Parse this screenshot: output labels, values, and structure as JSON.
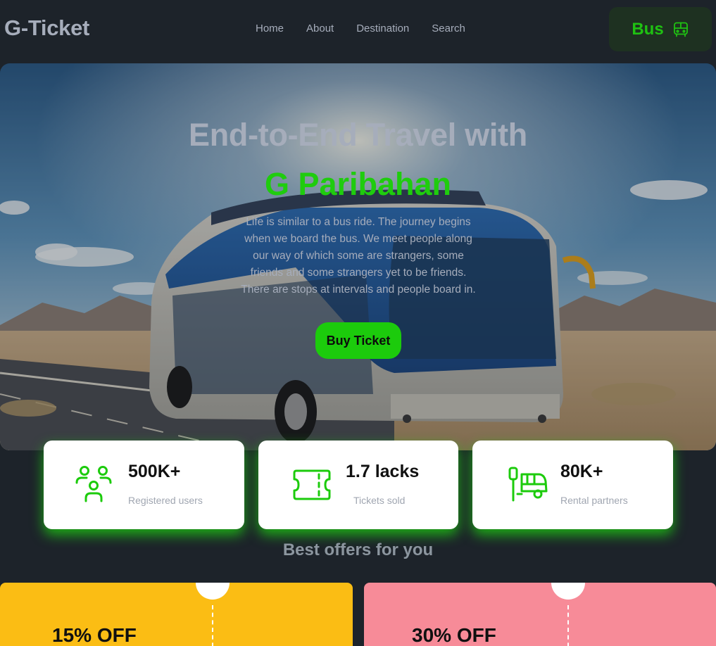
{
  "navbar": {
    "brand": "G-Ticket",
    "links": [
      "Home",
      "About",
      "Destination",
      "Search"
    ],
    "bus_button": {
      "label": "Bus",
      "icon": "bus-icon"
    }
  },
  "hero": {
    "title": "End-to-End Travel with",
    "brand_name": "G Paribahan",
    "description": "Life is similar to a bus ride. The journey begins when we board the bus. We meet people along our way of which some are strangers, some friends and some strangers yet to be friends. There are stops at intervals and people board in.",
    "cta_label": "Buy Ticket",
    "image": "bus-on-desert-road-photo"
  },
  "stats": [
    {
      "value": "500K+",
      "label": "Registered users",
      "icon": "users-icon"
    },
    {
      "value": "1.7 lacks",
      "label": "Tickets sold",
      "icon": "ticket-icon"
    },
    {
      "value": "80K+",
      "label": "Rental partners",
      "icon": "bus-stop-icon"
    }
  ],
  "offers": {
    "heading": "Best offers for you",
    "items": [
      {
        "title": "15% OFF",
        "color": "#fbbd14"
      },
      {
        "title": "30% OFF",
        "color": "#f78b98"
      }
    ]
  },
  "colors": {
    "background": "#1d232a",
    "accent_green": "#1fcc0e",
    "muted_text": "#a6adbb",
    "card_bg": "#ffffff"
  }
}
